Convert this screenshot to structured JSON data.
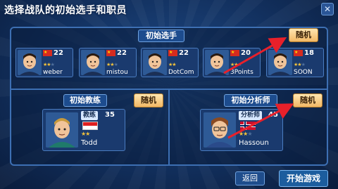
{
  "title": "选择战队的初始选手和职员",
  "sections": {
    "players_label": "初始选手",
    "coach_label": "初始教练",
    "analyst_label": "初始分析师",
    "random_label": "随机"
  },
  "players": [
    {
      "name": "weber",
      "age": "22",
      "stars": "★★",
      "stars_dim": "★",
      "flag": "CN"
    },
    {
      "name": "mistou",
      "age": "22",
      "stars": "★★",
      "stars_dim": "★",
      "flag": "CN"
    },
    {
      "name": "DotCom",
      "age": "22",
      "stars": "★★",
      "stars_dim": "",
      "flag": "CN"
    },
    {
      "name": "3Points",
      "age": "20",
      "stars": "★★",
      "stars_dim": "★",
      "flag": "CN"
    },
    {
      "name": "SOON",
      "age": "18",
      "stars": "★★",
      "stars_dim": "★",
      "flag": "CN"
    }
  ],
  "coach": {
    "role": "教练",
    "name": "Todd",
    "age": "35",
    "stars": "★★",
    "flag": "ID"
  },
  "analyst": {
    "role": "分析师",
    "name": "Hassoun",
    "age": "45",
    "stars": "★★",
    "stars_dim": "★",
    "flag": "NO"
  },
  "buttons": {
    "back": "返回",
    "start": "开始游戏"
  },
  "colors": {
    "accent": "#3d6fb3",
    "random_btn": "#f2b866",
    "arrow": "#e8202a"
  }
}
